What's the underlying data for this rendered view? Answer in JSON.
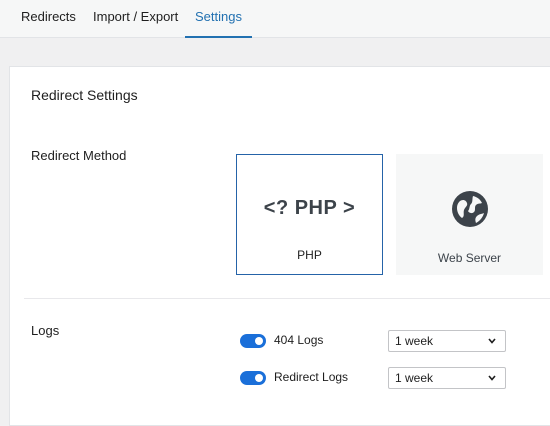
{
  "tabs": [
    {
      "label": "Redirects"
    },
    {
      "label": "Import / Export"
    },
    {
      "label": "Settings"
    }
  ],
  "active_tab": "Settings",
  "settings": {
    "title": "Redirect Settings",
    "redirect_method": {
      "label": "Redirect Method",
      "options": [
        {
          "label": "PHP",
          "glyph": "<? PHP >",
          "icon": "php-icon",
          "selected": true
        },
        {
          "label": "Web Server",
          "icon": "globe-icon",
          "selected": false
        }
      ]
    },
    "logs": {
      "label": "Logs",
      "items": [
        {
          "label": "404 Logs",
          "enabled": true,
          "retention": "1 week"
        },
        {
          "label": "Redirect Logs",
          "enabled": true,
          "retention": "1 week"
        }
      ]
    }
  },
  "colors": {
    "accent": "#2271b1",
    "toggle_on": "#1a6fd9"
  }
}
